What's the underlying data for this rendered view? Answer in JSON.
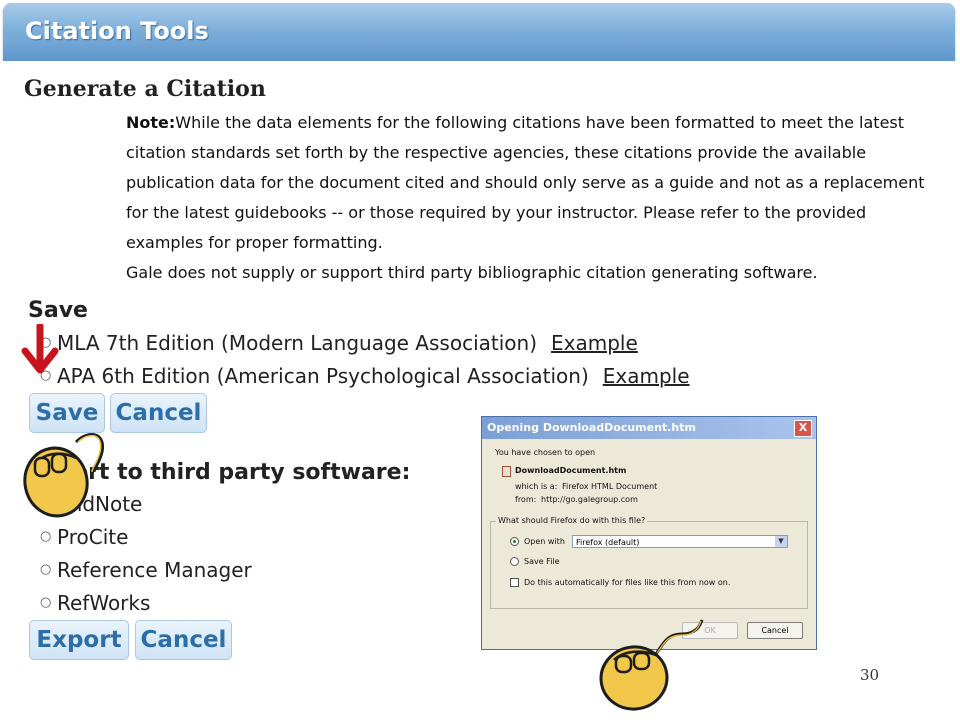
{
  "header": {
    "title": "Citation Tools"
  },
  "generate": {
    "title": "Generate a Citation",
    "note_label": "Note:",
    "note_text": "While the data elements for the following citations have been formatted to meet the latest citation standards set forth by the respective agencies, these citations provide the available publication data for the document cited and should only serve as a guide and not as a replacement for the latest guidebooks -- or those required by your instructor. Please refer to the provided examples for proper formatting.",
    "gale_text": "Gale does not supply or support third party bibliographic citation generating software."
  },
  "save": {
    "title": "Save",
    "options": [
      {
        "label": "MLA 7th Edition (Modern Language Association)",
        "link": "Example"
      },
      {
        "label": "APA 6th Edition (American Psychological Association)",
        "link": "Example"
      }
    ],
    "save_label": "Save",
    "cancel_label": "Cancel"
  },
  "export": {
    "title": "Export to third party software:",
    "options": [
      "EndNote",
      "ProCite",
      "Reference Manager",
      "RefWorks"
    ],
    "export_label": "Export",
    "cancel_label": "Cancel"
  },
  "dialog": {
    "title": "Opening DownloadDocument.htm",
    "close": "X",
    "chosen_text": "You have chosen to open",
    "filename": "DownloadDocument.htm",
    "which_is_label": "which is a:",
    "which_is_value": "Firefox HTML Document",
    "from_label": "from:",
    "from_value": "http://go.galegroup.com",
    "question": "What should Firefox do with this file?",
    "open_with_label": "Open with",
    "open_with_value": "Firefox (default)",
    "save_file_label": "Save File",
    "auto_label": "Do this automatically for files like this from now on.",
    "ok_label": "OK",
    "cancel_label": "Cancel"
  },
  "page_number": "30",
  "colors": {
    "header": "#7fb0dc",
    "button_text": "#2d6ea8",
    "arrow": "#c8141e",
    "hand": "#f2c84b"
  }
}
